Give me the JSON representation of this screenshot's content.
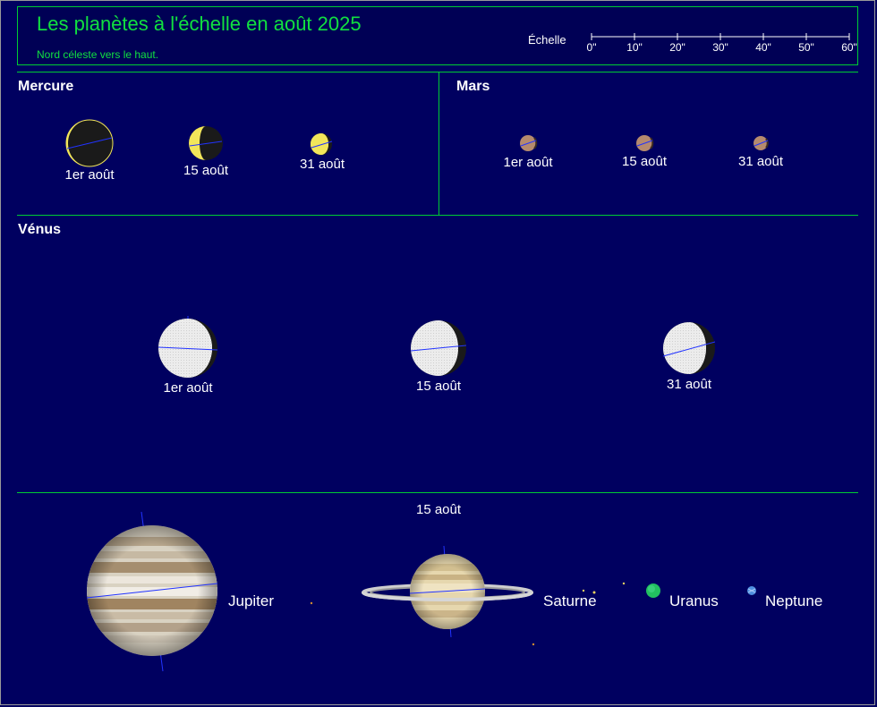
{
  "header": {
    "title": "Les planètes à l'échelle en août 2025",
    "subtitle": "Nord céleste vers le haut.",
    "scale_label": "Échelle",
    "scale_ticks": [
      "0\"",
      "10\"",
      "20\"",
      "30\"",
      "40\"",
      "50\"",
      "60\""
    ]
  },
  "mercury": {
    "title": "Mercure",
    "dates": [
      "1er août",
      "15 août",
      "31 août"
    ],
    "phases": [
      "thin waning crescent",
      "crescent",
      "gibbous"
    ]
  },
  "mars": {
    "title": "Mars",
    "dates": [
      "1er août",
      "15 août",
      "31 août"
    ]
  },
  "venus": {
    "title": "Vénus",
    "dates": [
      "1er août",
      "15 août",
      "31 août"
    ],
    "phases": [
      "gibbous",
      "gibbous",
      "gibbous"
    ]
  },
  "outer": {
    "date": "15 août",
    "jupiter": "Jupiter",
    "saturn": "Saturne",
    "uranus": "Uranus",
    "neptune": "Neptune"
  },
  "colors": {
    "background": "#000060",
    "accent_green": "#11e040",
    "axis_blue": "#2233ff",
    "mercury": "#f2e65a",
    "mars": "#b58a6e",
    "uranus": "#22c060",
    "neptune": "#4f8fe0"
  },
  "icons": {
    "jupiter": "jupiter-disc",
    "saturn": "saturn-rings",
    "moon": "satellite-dot"
  }
}
